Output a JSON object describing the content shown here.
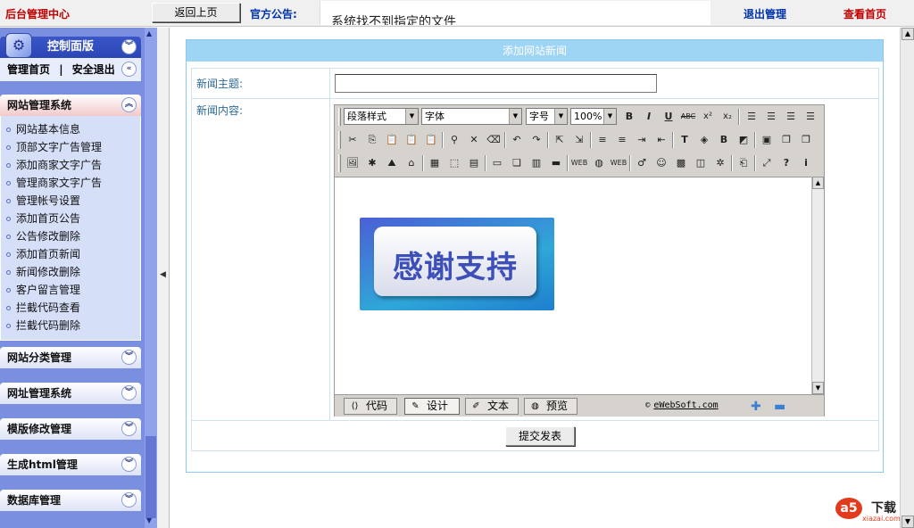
{
  "topbar": {
    "title": "后台管理中心",
    "back_button": "返回上页",
    "notice_label": "官方公告:",
    "notice_text": "系统找不到指定的文件",
    "logout": "退出管理",
    "view_home": "查看首页"
  },
  "sidebar": {
    "control_panel": "控制面版",
    "home_link": "管理首页",
    "separator": "|",
    "safe_exit": "安全退出",
    "site_manage": {
      "title": "网站管理系统",
      "items": [
        "网站基本信息",
        "顶部文字广告管理",
        "添加商家文字广告",
        "管理商家文字广告",
        "管理帐号设置",
        "添加首页公告",
        "公告修改删除",
        "添加首页新闻",
        "新闻修改删除",
        "客户留言管理",
        "拦截代码查看",
        "拦截代码删除"
      ]
    },
    "collapsed": [
      "网站分类管理",
      "网址管理系统",
      "模版修改管理",
      "生成html管理",
      "数据库管理"
    ]
  },
  "form": {
    "title": "添加网站新闻",
    "subject_label": "新闻主题:",
    "subject_value": "",
    "content_label": "新闻内容:",
    "submit": "提交发表"
  },
  "editor": {
    "paragraph_style": "段落样式",
    "font": "字体",
    "font_size": "字号",
    "zoom": "100%",
    "banner_text": "感谢支持",
    "modes": [
      "代码",
      "设计",
      "文本",
      "预览"
    ],
    "active_mode": "设计",
    "copyright": "eWebSoft.com"
  },
  "watermark": {
    "logo": "a5",
    "title": "下载",
    "domain": "xiazai.com"
  },
  "colors": {
    "sidebar": "#7b8fe0",
    "title_red": "#c00000",
    "link_blue": "#0033aa",
    "form_header": "#9ed4f4"
  }
}
